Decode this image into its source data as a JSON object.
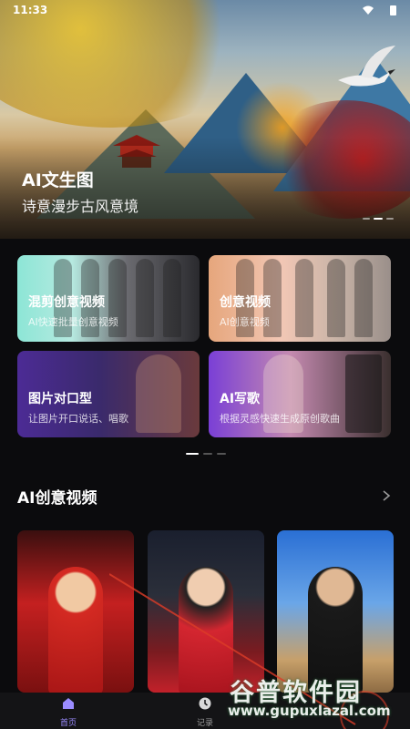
{
  "status_bar": {
    "time": "11:33"
  },
  "hero": {
    "title": "AI文生图",
    "subtitle": "诗意漫步古风意境",
    "slides": 3,
    "active_slide": 2
  },
  "feature_cards": [
    {
      "title": "混剪创意视频",
      "desc": "AI快速批量创意视频"
    },
    {
      "title": "创意视频",
      "desc": "AI创意视频"
    },
    {
      "title": "图片对口型",
      "desc": "让图片开口说话、唱歌"
    },
    {
      "title": "AI写歌",
      "desc": "根据灵感快速生成原创歌曲"
    }
  ],
  "section": {
    "title": "AI创意视频"
  },
  "videos": [
    {
      "id": "v1"
    },
    {
      "id": "v2"
    },
    {
      "id": "v3"
    }
  ],
  "tabbar": {
    "home_label": "首页",
    "record_label": "记录"
  },
  "watermark": {
    "title": "谷普软件园",
    "url": "www.gupuxlazal.com"
  },
  "colors": {
    "accent": "#9b8cff",
    "background": "#0b0b0d"
  },
  "icons": {
    "home": "home-icon",
    "record": "clock-icon",
    "arrow": "chevron-right-icon",
    "wifi": "wifi-icon",
    "battery": "battery-icon"
  }
}
